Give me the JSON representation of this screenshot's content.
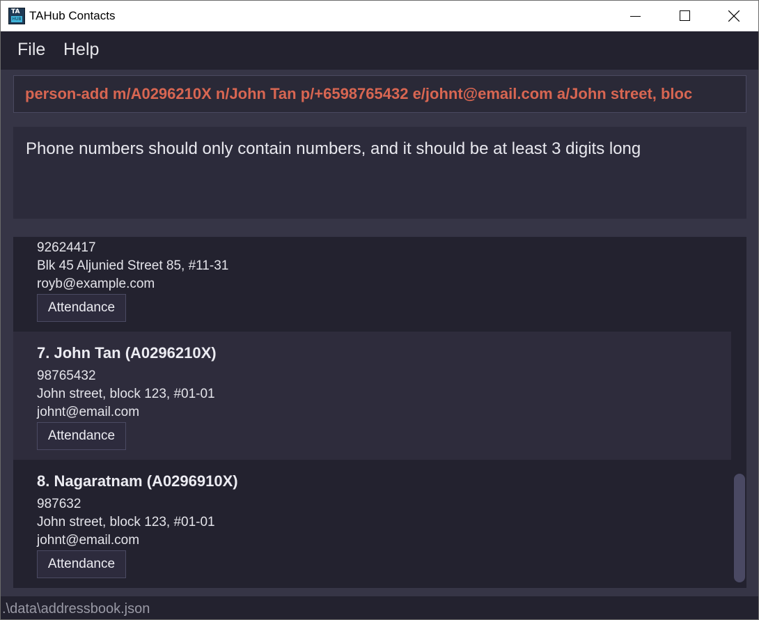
{
  "window": {
    "title": "TAHub Contacts",
    "icon_top": "TA",
    "icon_bottom": "HUB"
  },
  "menu": {
    "file": "File",
    "help": "Help"
  },
  "command": {
    "text": "person-add m/A0296210X n/John Tan p/+6598765432 e/johnt@email.com a/John street, bloc"
  },
  "result": {
    "message": "Phone numbers should only contain numbers, and it should be at least 3 digits long"
  },
  "persons": [
    {
      "phone": "92624417",
      "address": "Blk 45 Aljunied Street 85, #11-31",
      "email": "royb@example.com",
      "attendance_label": "Attendance"
    },
    {
      "title": "7.  John Tan  (A0296210X)",
      "phone": "98765432",
      "address": "John street, block 123, #01-01",
      "email": "johnt@email.com",
      "attendance_label": "Attendance"
    },
    {
      "title": "8.  Nagaratnam  (A0296910X)",
      "phone": "987632",
      "address": "John street, block 123, #01-01",
      "email": "johnt@email.com",
      "attendance_label": "Attendance"
    }
  ],
  "status": {
    "file_path": ".\\data\\addressbook.json"
  },
  "colors": {
    "command_text": "#d86652",
    "background": "#23222f",
    "panel": "#363546"
  }
}
